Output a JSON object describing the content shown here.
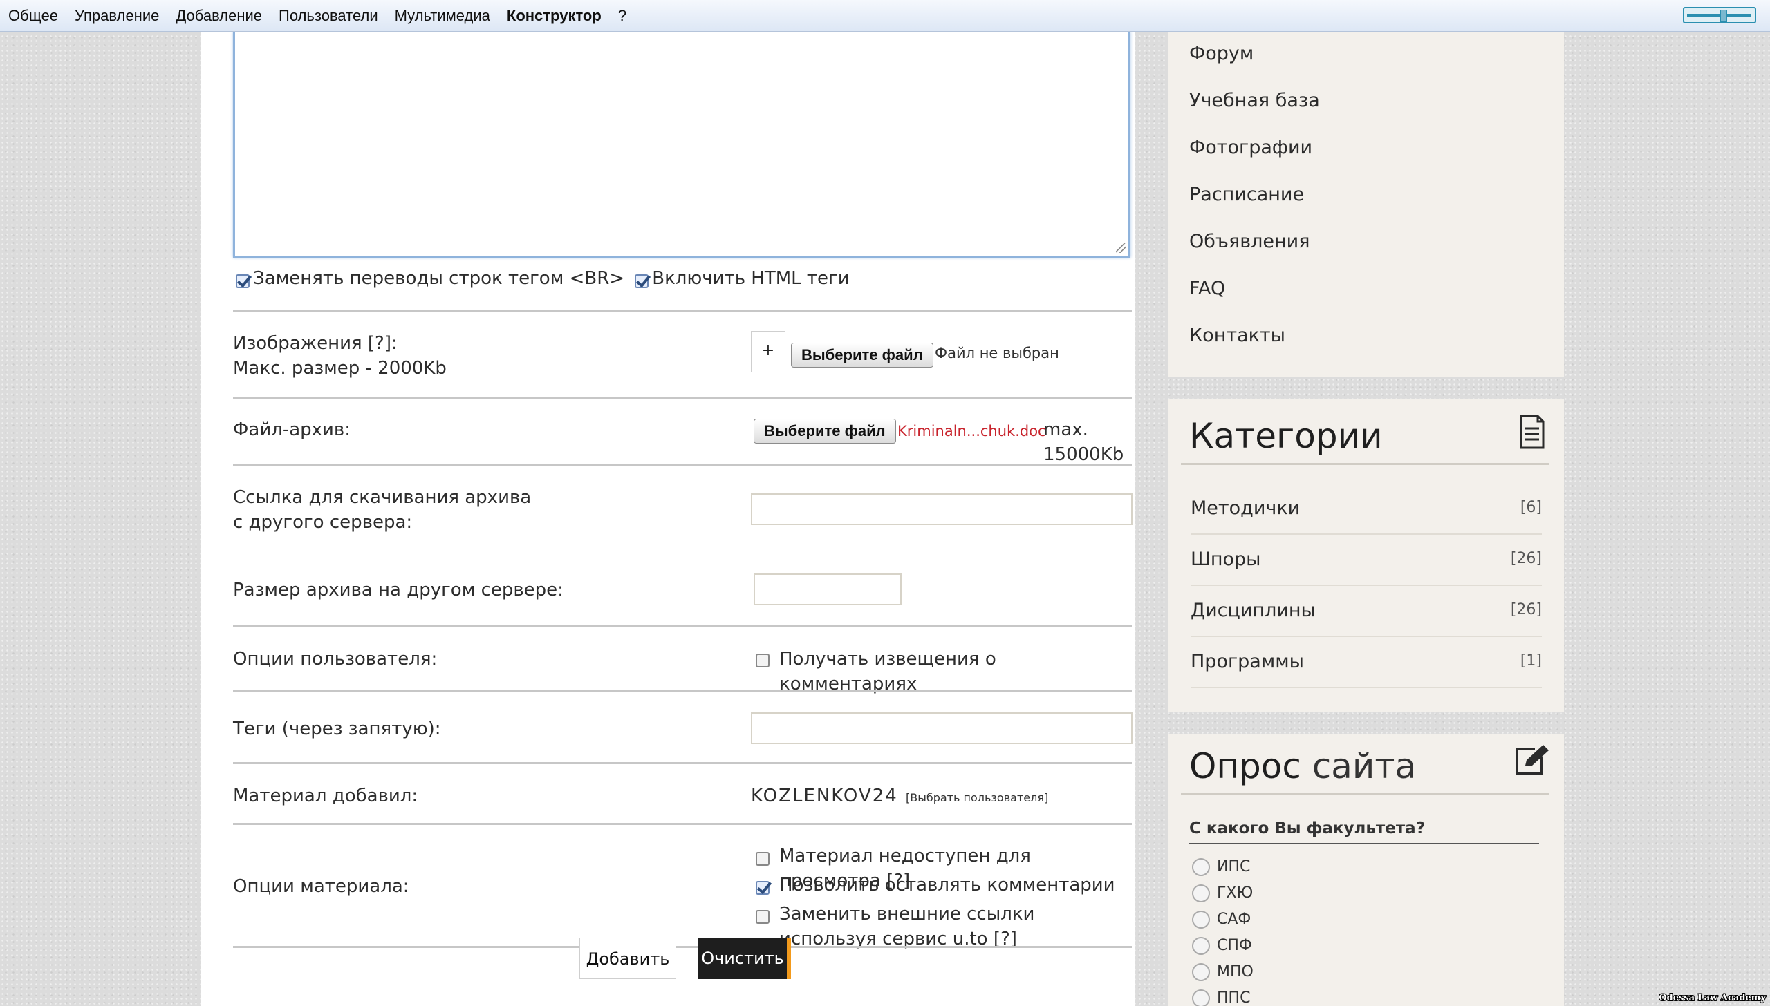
{
  "topbar": {
    "menu": [
      "Общее",
      "Управление",
      "Добавление",
      "Пользователи",
      "Мультимедиа",
      "Конструктор",
      "?"
    ],
    "active_item": "Конструктор"
  },
  "form": {
    "br_label": "Заменять переводы строк тегом <BR>",
    "br_checked": true,
    "html_label": "Включить HTML теги",
    "html_checked": true,
    "images_label_line1": "Изображения [?]:",
    "images_label_line2": "Макс. размер - 2000Kb",
    "plus_label": "+",
    "choose_file_label": "Выберите файл",
    "no_file_text": "Файл не выбран",
    "archive_label": "Файл-архив:",
    "archive_file_name": "Kriminaln...chuk.doc",
    "archive_max": "max. 15000Kb",
    "download_link_label": "Ссылка для скачивания архива с другого сервера:",
    "download_link_value": "",
    "archive_size_label": "Размер архива на другом сервере:",
    "archive_size_value": "",
    "user_options_label": "Опции пользователя:",
    "notify_label": "Получать извещения о комментариях",
    "notify_checked": false,
    "tags_label": "Теги (через запятую):",
    "tags_value": "",
    "added_by_label": "Материал добавил:",
    "added_by_user": "KOZLENKOV24",
    "choose_user_label": "[Выбрать пользователя]",
    "material_options_label": "Опции материала:",
    "option_unavailable": "Материал недоступен для просмотра [?]",
    "option_unavailable_checked": false,
    "option_comments": "Позволить оставлять комментарии",
    "option_comments_checked": true,
    "option_links": "Заменить внешние ссылки используя сервис u.to [?]",
    "option_links_checked": false,
    "add_button": "Добавить",
    "clear_button": "Очистить"
  },
  "sidebar": {
    "nav": [
      "Форум",
      "Учебная база",
      "Фотографии",
      "Расписание",
      "Объявления",
      "FAQ",
      "Контакты"
    ],
    "categories_title": "Категории",
    "categories": [
      {
        "name": "Методички",
        "count": "[6]"
      },
      {
        "name": "Шпоры",
        "count": "[26]"
      },
      {
        "name": "Дисциплины",
        "count": "[26]"
      },
      {
        "name": "Программы",
        "count": "[1]"
      }
    ],
    "poll_title_strong": "Опрос",
    "poll_title_rest": "сайта",
    "poll_question": "С какого Вы факультета?",
    "poll_options": [
      "ИПС",
      "ГХЮ",
      "САФ",
      "СПФ",
      "МПО",
      "ППС"
    ]
  },
  "watermark": "Odessa Law Academy",
  "colors": {
    "accent_orange": "#f39a1c",
    "dark_button": "#1e1e1e",
    "file_name_red": "#c8232c",
    "textarea_focus": "#8fb3dc"
  }
}
